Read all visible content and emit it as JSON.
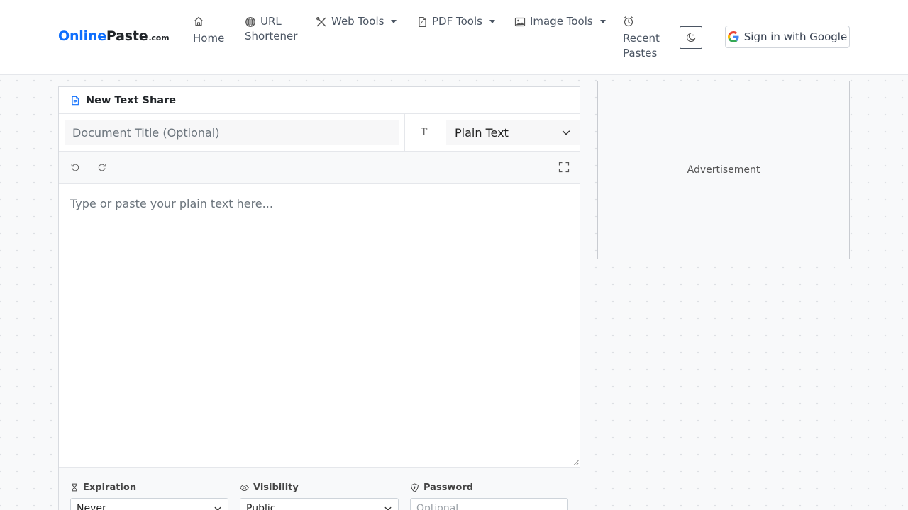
{
  "brand": {
    "part1": "Online",
    "part2": "Paste",
    "part3": ".com"
  },
  "nav": {
    "home": "Home",
    "url_shortener_line1": "URL",
    "url_shortener_line2": "Shortener",
    "web_tools": "Web Tools",
    "pdf_tools": "PDF Tools",
    "image_tools": "Image Tools",
    "recent_line1": "Recent",
    "recent_line2": "Pastes",
    "sign_in": "Sign in with Google"
  },
  "editor_card": {
    "header_title": "New Text Share",
    "title_placeholder": "Document Title (Optional)",
    "language_icon": "T",
    "language_selected": "Plain Text",
    "editor_placeholder": "Type or paste your plain text here..."
  },
  "options": {
    "expiration_label": "Expiration",
    "expiration_value": "Never",
    "visibility_label": "Visibility",
    "visibility_value": "Public",
    "password_label": "Password",
    "password_placeholder": "Optional"
  },
  "ad": {
    "label": "Advertisement"
  },
  "icons": {
    "home": "home-icon",
    "url": "globe-icon",
    "web_tools": "tools-icon",
    "pdf": "file-pdf-icon",
    "image": "image-icon",
    "recent": "alarm-clock-icon",
    "theme": "moon-stars-icon",
    "google": "google-logo-icon"
  },
  "colors": {
    "brand_blue": "#0d6efd",
    "text": "#212529"
  }
}
